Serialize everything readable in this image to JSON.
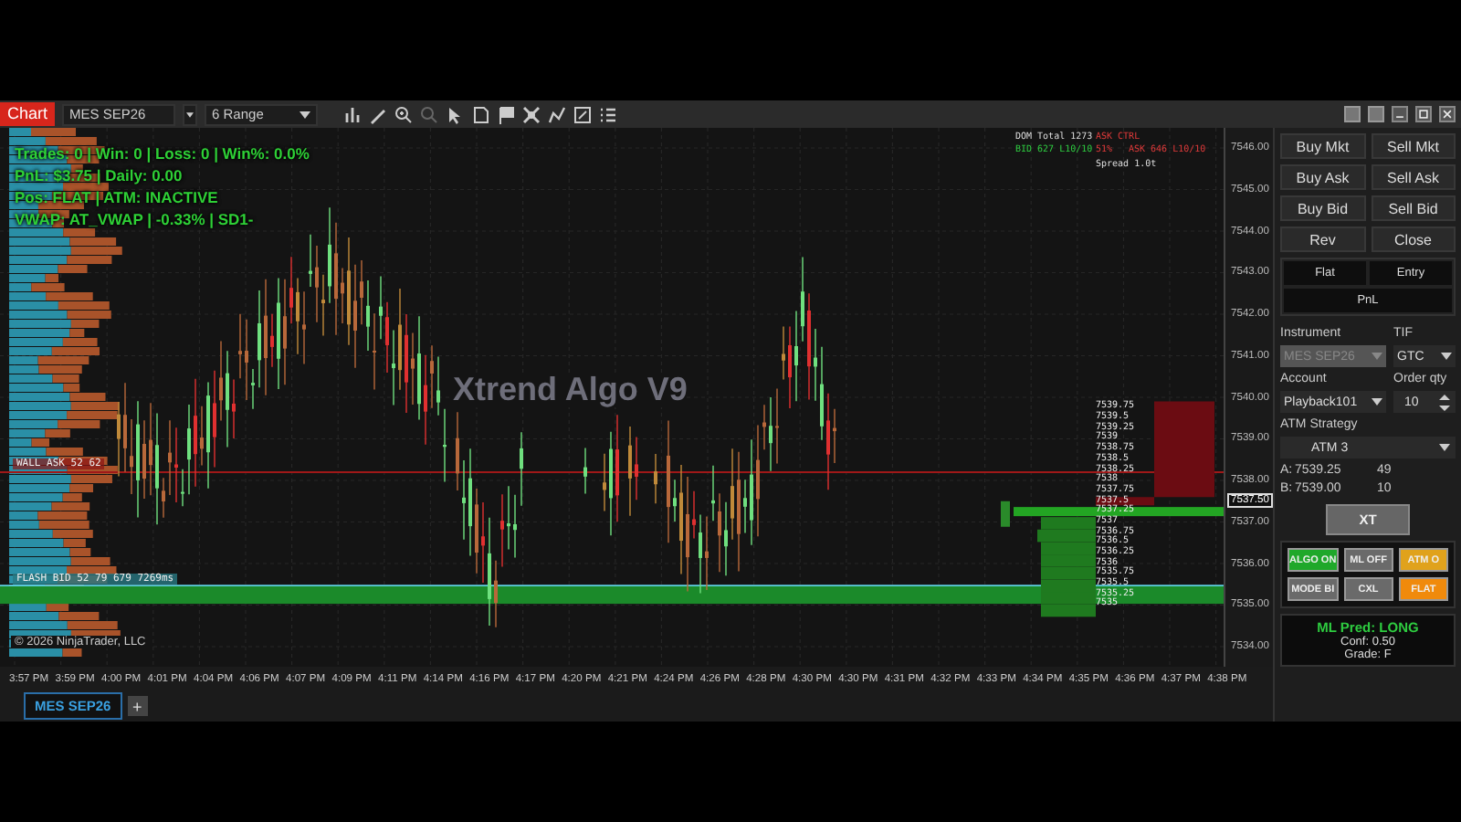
{
  "toolbar": {
    "badge": "Chart",
    "instrument": "MES SEP26",
    "period": "6 Range"
  },
  "stats": [
    "Trades: 0 | Win: 0 | Loss: 0 | Win%: 0.0%",
    "PnL: $3.75 | Daily: 0.00",
    "Pos: FLAT | ATM: INACTIVE",
    "VWAP: AT_VWAP | -0.33% | SD1-"
  ],
  "watermark": "Xtrend Algo V9",
  "copyright": "© 2026 NinjaTrader, LLC",
  "levels": [
    {
      "label": "WALL ASK 52 62",
      "kind": "ask"
    },
    {
      "label": "FLASH BID 52 79 679 7269ms",
      "kind": "bid"
    }
  ],
  "dom_header": {
    "total": "DOM Total 1273",
    "bid": "BID 627 L10/10",
    "ask_ctrl": "ASK CTRL",
    "ask_pct": "51%",
    "ask": "ASK 646 L10/10",
    "spread": "Spread 1.0t"
  },
  "ladder_prices": [
    "7539.75",
    "7539.5",
    "7539.25",
    "7539",
    "7538.75",
    "7538.5",
    "7538.25",
    "7538",
    "7537.75",
    "7537.5",
    "7537.25",
    "7537",
    "7536.75",
    "7536.5",
    "7536.25",
    "7536",
    "7535.75",
    "7535.5",
    "7535.25",
    "7535"
  ],
  "price_axis": [
    "7546.00",
    "7545.00",
    "7544.00",
    "7543.00",
    "7542.00",
    "7541.00",
    "7540.00",
    "7539.00",
    "7538.00",
    "7537.00",
    "7536.00",
    "7535.00",
    "7534.00"
  ],
  "current_price": "7537.50",
  "time_axis": [
    "3:57 PM",
    "3:59 PM",
    "4:00 PM",
    "4:01 PM",
    "4:04 PM",
    "4:06 PM",
    "4:07 PM",
    "4:09 PM",
    "4:11 PM",
    "4:14 PM",
    "4:16 PM",
    "4:17 PM",
    "4:20 PM",
    "4:21 PM",
    "4:24 PM",
    "4:26 PM",
    "4:28 PM",
    "4:30 PM",
    "4:30 PM",
    "4:31 PM",
    "4:32 PM",
    "4:33 PM",
    "4:34 PM",
    "4:35 PM",
    "4:36 PM",
    "4:37 PM",
    "4:38 PM"
  ],
  "tabs": [
    {
      "label": "MES SEP26",
      "selected": true
    }
  ],
  "add_tab": "+",
  "panel": {
    "order_buttons": [
      "Buy Mkt",
      "Sell Mkt",
      "Buy Ask",
      "Sell Ask",
      "Buy Bid",
      "Sell Bid",
      "Rev",
      "Close"
    ],
    "mode_cells": [
      "Flat",
      "Entry",
      "PnL"
    ],
    "instrument_label": "Instrument",
    "instrument": {
      "value": "MES SEP26",
      "disabled": true
    },
    "tif_label": "TIF",
    "tif": "GTC",
    "account_label": "Account",
    "account": "Playback101",
    "qty_label": "Order qty",
    "qty": "10",
    "atm_label": "ATM Strategy",
    "atm": "ATM 3",
    "quotes": [
      {
        "side": "A:",
        "price": "7539.25",
        "size": "49"
      },
      {
        "side": "B:",
        "price": "7539.00",
        "size": "10"
      }
    ],
    "xt": "XT",
    "algo_buttons": [
      {
        "label": "ALGO ON",
        "color": "#1fa82a"
      },
      {
        "label": "ML OFF",
        "color": "#6a6a6a"
      },
      {
        "label": "ATM O",
        "color": "#e0a21c"
      },
      {
        "label": "MODE BI",
        "color": "#6a6a6a"
      },
      {
        "label": "CXL",
        "color": "#6a6a6a"
      },
      {
        "label": "FLAT",
        "color": "#f08a0c"
      }
    ],
    "prediction": {
      "title": "ML Pred: LONG",
      "conf": "Conf: 0.50",
      "grade": "Grade: F"
    }
  }
}
